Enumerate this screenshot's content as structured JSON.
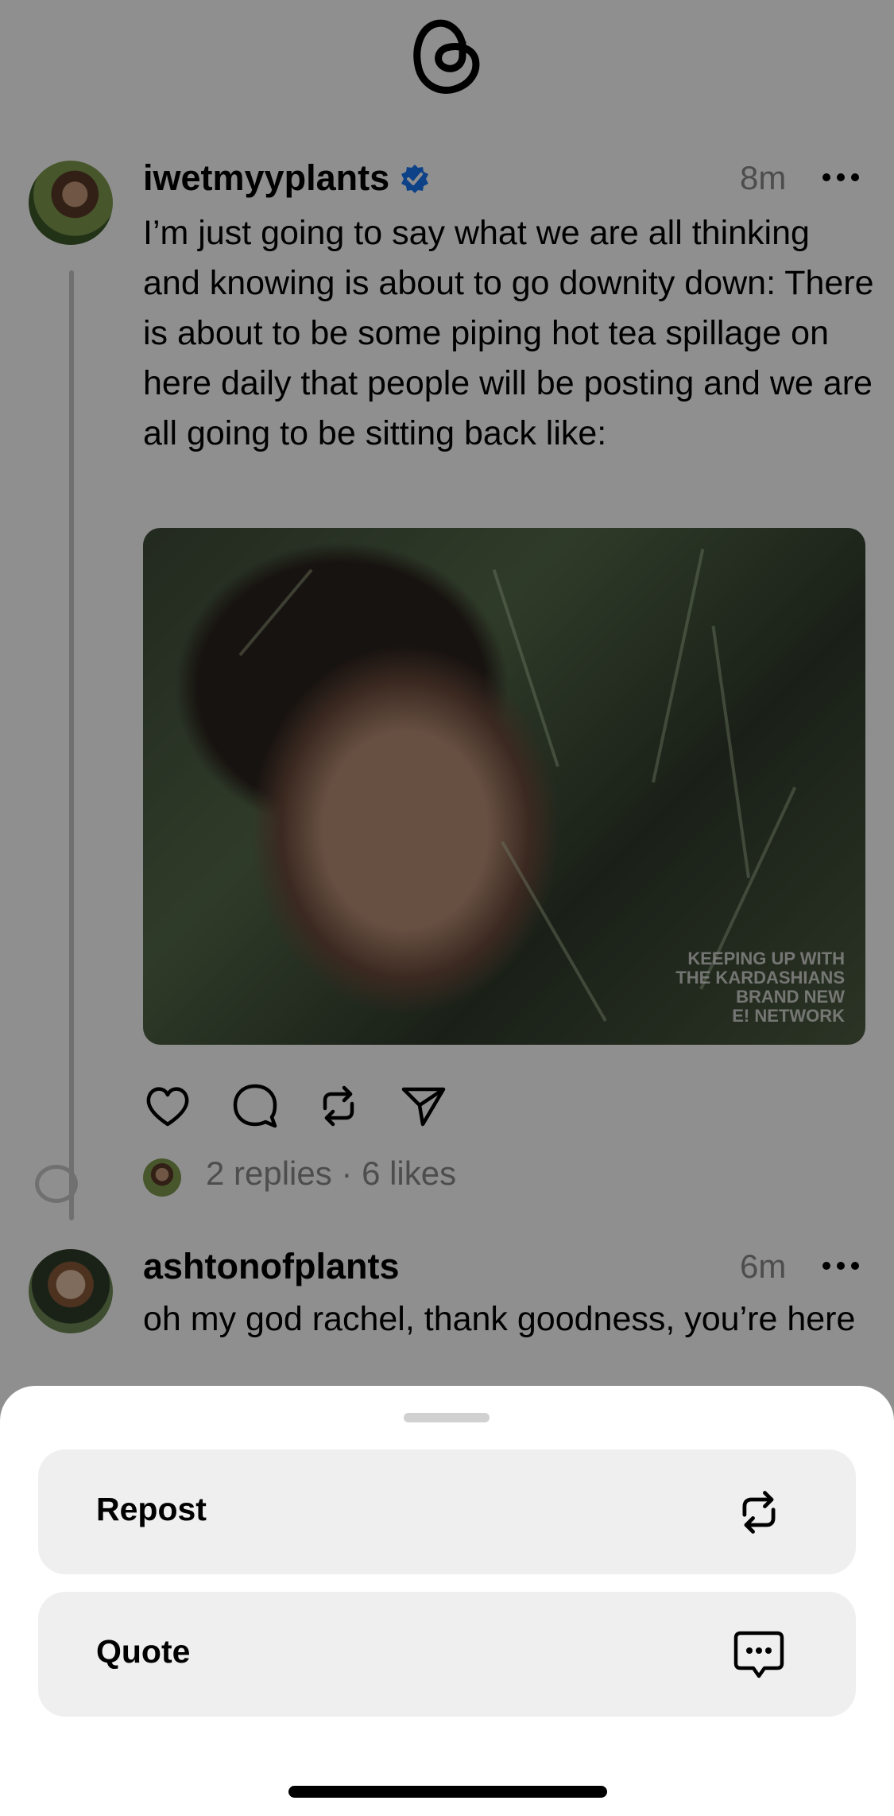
{
  "header": {
    "logo_icon": "threads-logo-icon"
  },
  "posts": [
    {
      "username": "iwetmyyplants",
      "verified": true,
      "time": "8m",
      "text": "I’m just going to say what we are all thinking and knowing is about to go downity down: There is about to be some piping hot tea spillage on here daily that people will be posting and we are all going to be sitting back like:",
      "media": {
        "watermark": "KEEPING UP WITH\nTHE KARDASHIANS\nBRAND NEW\nE! NETWORK"
      },
      "stats": "2 replies · 6 likes"
    },
    {
      "username": "ashtonofplants",
      "time": "6m",
      "text": "oh my god rachel, thank goodness, you’re here"
    }
  ],
  "sheet": {
    "options": [
      {
        "label": "Repost",
        "icon": "repost-icon"
      },
      {
        "label": "Quote",
        "icon": "quote-bubble-icon"
      }
    ]
  },
  "colors": {
    "verified": "#1877F2",
    "secondary_text": "#8A8A8A",
    "option_bg": "#EFEFEF"
  }
}
